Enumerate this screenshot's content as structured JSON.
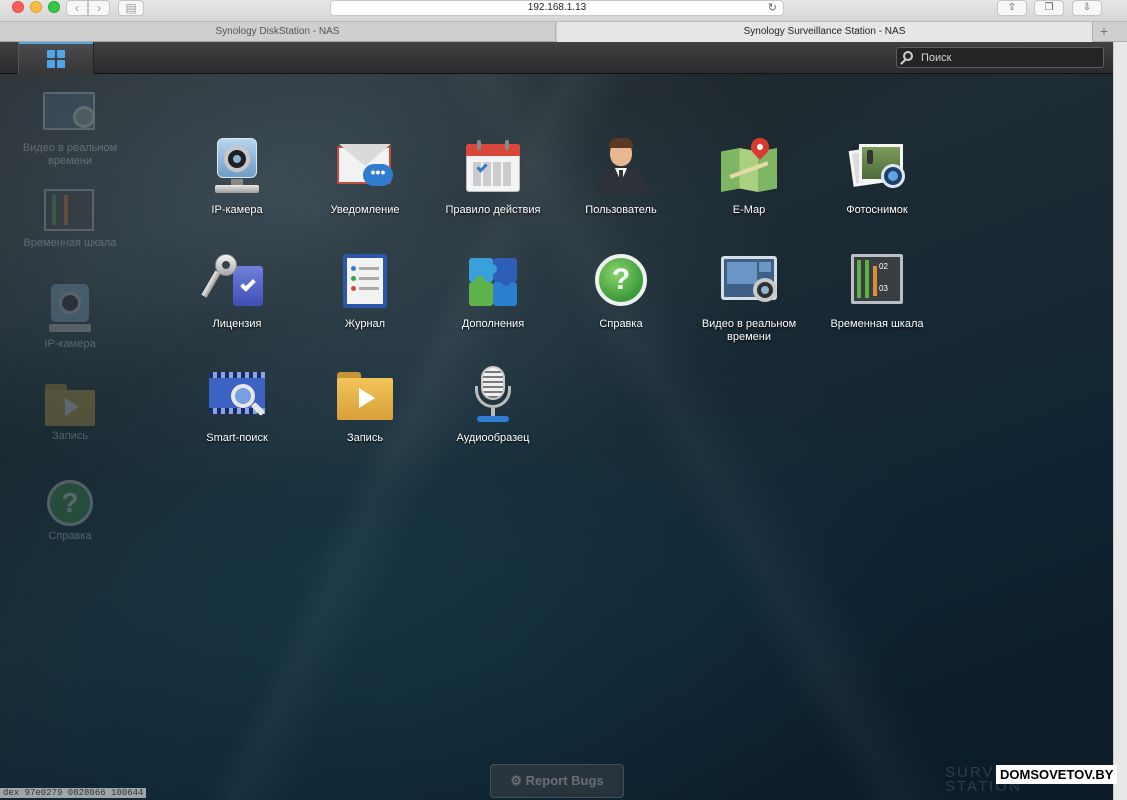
{
  "browser": {
    "url": "192.168.1.13",
    "tabs": [
      {
        "label": "Synology DiskStation - NAS"
      },
      {
        "label": "Synology Surveillance Station - NAS"
      }
    ],
    "new_tab_glyph": "+",
    "icons": [
      "back-icon",
      "forward-icon",
      "sidebar-icon",
      "reload-icon",
      "share-icon",
      "tabs-icon",
      "download-icon"
    ]
  },
  "taskbar": {
    "menu_icon": "main-menu-grid-icon",
    "search_placeholder": "Поиск"
  },
  "desktop": {
    "shortcuts": [
      {
        "label": "Видео в реальном времени",
        "icon": "live-view-icon"
      },
      {
        "label": "Временная шкала",
        "icon": "timeline-icon"
      },
      {
        "label": "IP-камера",
        "icon": "ip-camera-icon"
      },
      {
        "label": "Запись",
        "icon": "recording-folder-icon"
      },
      {
        "label": "Справка",
        "icon": "help-icon"
      }
    ]
  },
  "main_menu": {
    "items": [
      {
        "label": "IP-камера",
        "icon": "ip-camera-icon"
      },
      {
        "label": "Уведомление",
        "icon": "notification-icon"
      },
      {
        "label": "Правило действия",
        "icon": "action-rule-icon"
      },
      {
        "label": "Пользователь",
        "icon": "user-icon"
      },
      {
        "label": "E-Map",
        "icon": "emap-icon"
      },
      {
        "label": "Фотоснимок",
        "icon": "snapshot-icon"
      },
      {
        "label": "Лицензия",
        "icon": "license-icon"
      },
      {
        "label": "Журнал",
        "icon": "log-icon"
      },
      {
        "label": "Дополнения",
        "icon": "addons-icon"
      },
      {
        "label": "Справка",
        "icon": "help-icon"
      },
      {
        "label": "Видео в реальном времени",
        "icon": "live-view-icon"
      },
      {
        "label": "Временная шкала",
        "icon": "timeline-icon"
      },
      {
        "label": "Smart-поиск",
        "icon": "smart-search-icon"
      },
      {
        "label": "Запись",
        "icon": "recording-folder-icon"
      },
      {
        "label": "Аудиообразец",
        "icon": "audio-pattern-icon"
      }
    ]
  },
  "timeline_icon_text": {
    "top": "02",
    "bottom": "03"
  },
  "footer": {
    "report_bugs": "Report Bugs",
    "logo_text_1": "SURVEILLANCE",
    "logo_text_2": "STATION"
  },
  "watermark": "DOMSOVETOV.BY",
  "bottom_status": "dex 97e0279 0828066 100644"
}
